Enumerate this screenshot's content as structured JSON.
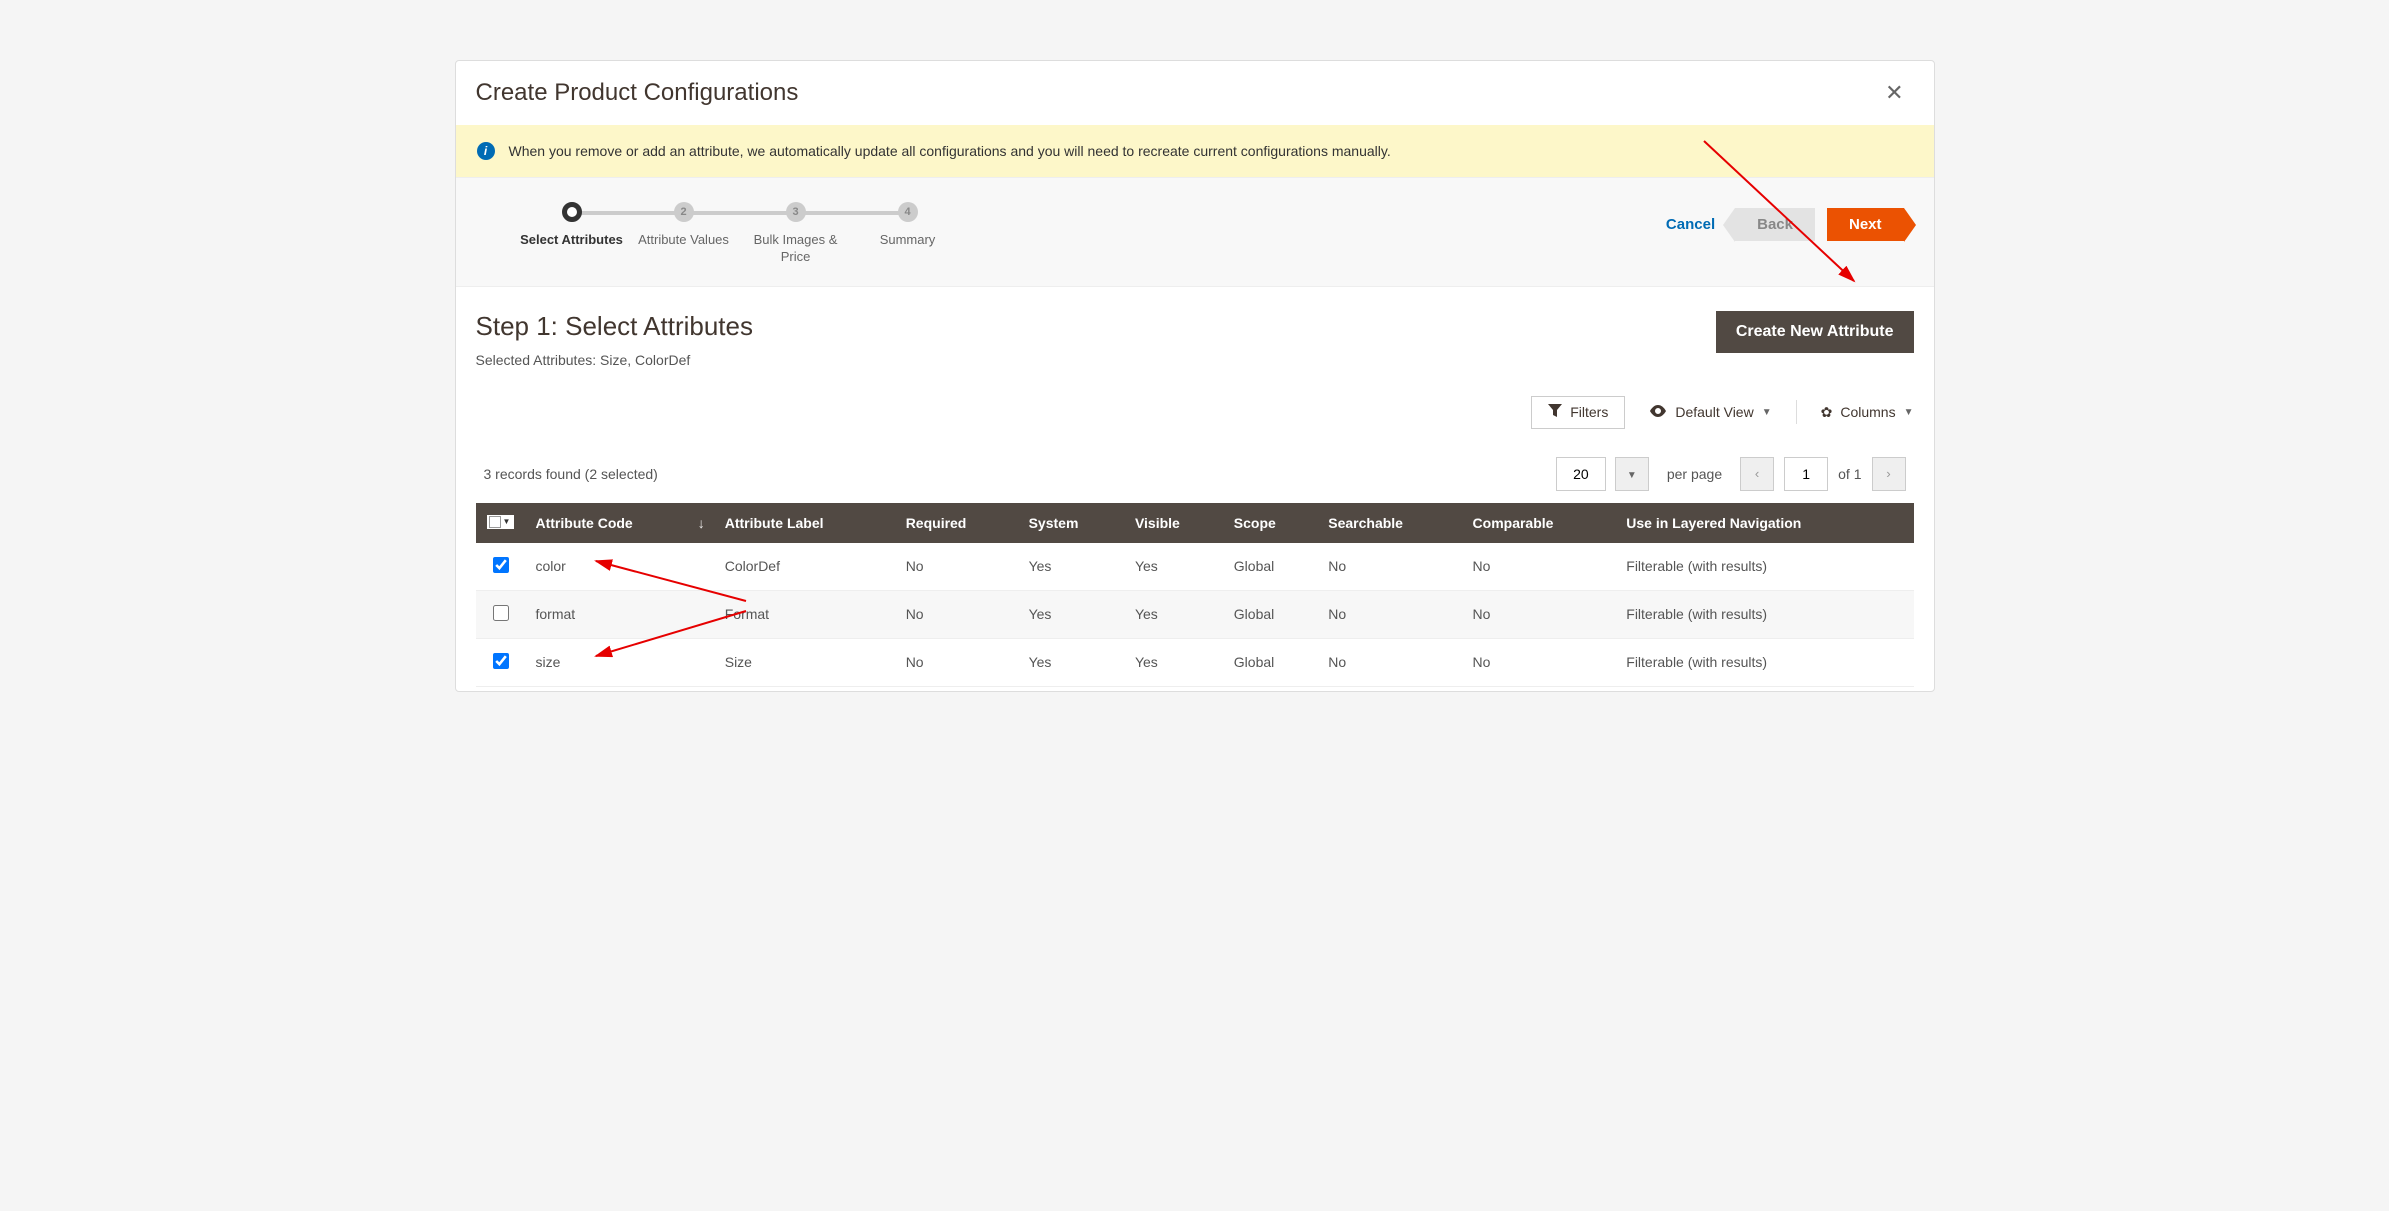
{
  "modal": {
    "title": "Create Product Configurations",
    "info_text": "When you remove or add an attribute, we automatically update all configurations and you will need to recreate current configurations manually."
  },
  "wizard": {
    "steps": [
      {
        "num": "",
        "label": "Select Attributes"
      },
      {
        "num": "2",
        "label": "Attribute Values"
      },
      {
        "num": "3",
        "label": "Bulk Images & Price"
      },
      {
        "num": "4",
        "label": "Summary"
      }
    ],
    "cancel": "Cancel",
    "back": "Back",
    "next": "Next"
  },
  "step": {
    "title": "Step 1: Select Attributes",
    "selected": "Selected Attributes: Size, ColorDef",
    "create_btn": "Create New Attribute"
  },
  "toolbar": {
    "filters": "Filters",
    "view": "Default View",
    "columns": "Columns"
  },
  "records": {
    "found": "3 records found (2 selected)",
    "page_size": "20",
    "per_page": "per page",
    "page": "1",
    "of": "of 1"
  },
  "table": {
    "headers": {
      "code": "Attribute Code",
      "label": "Attribute Label",
      "required": "Required",
      "system": "System",
      "visible": "Visible",
      "scope": "Scope",
      "searchable": "Searchable",
      "comparable": "Comparable",
      "layered": "Use in Layered Navigation"
    },
    "rows": [
      {
        "checked": true,
        "code": "color",
        "label": "ColorDef",
        "required": "No",
        "system": "Yes",
        "visible": "Yes",
        "scope": "Global",
        "searchable": "No",
        "comparable": "No",
        "layered": "Filterable (with results)"
      },
      {
        "checked": false,
        "code": "format",
        "label": "Format",
        "required": "No",
        "system": "Yes",
        "visible": "Yes",
        "scope": "Global",
        "searchable": "No",
        "comparable": "No",
        "layered": "Filterable (with results)"
      },
      {
        "checked": true,
        "code": "size",
        "label": "Size",
        "required": "No",
        "system": "Yes",
        "visible": "Yes",
        "scope": "Global",
        "searchable": "No",
        "comparable": "No",
        "layered": "Filterable (with results)"
      }
    ]
  }
}
